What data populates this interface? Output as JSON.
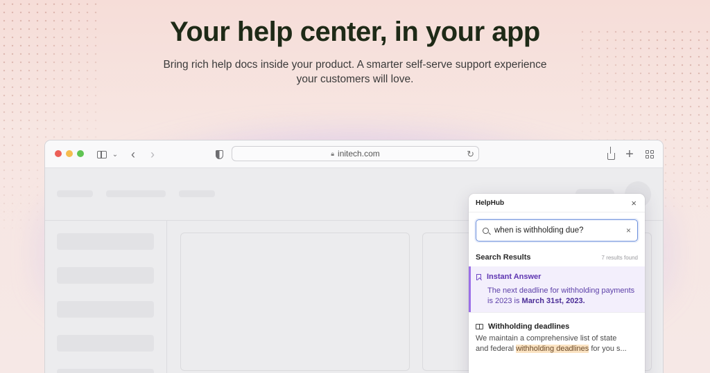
{
  "hero": {
    "title": "Your help center, in your app",
    "subtitle": "Bring rich help docs inside your product. A smarter self-serve support experience your customers will love."
  },
  "browser": {
    "url": "initech.com",
    "icons": [
      "sidebar-icon",
      "chevron-down-icon",
      "back-arrow-icon",
      "forward-arrow-icon",
      "shield-icon",
      "lock-icon",
      "reload-icon",
      "share-icon",
      "plus-icon",
      "tab-grid-icon"
    ]
  },
  "helphub": {
    "title": "HelpHub",
    "close_glyph": "×",
    "search_value": "when is withholding due?",
    "clear_glyph": "×",
    "results_title": "Search Results",
    "results_count": "7 results found",
    "instant_answer": {
      "title": "Instant Answer",
      "body_prefix": "The next deadline for withholding payments is 2023 is ",
      "body_emphasis": "March 31st, 2023."
    },
    "result2": {
      "title": "Withholding deadlines",
      "line1": "We maintain a comprehensive list of state",
      "line2_prefix": "and federal ",
      "line2_highlight": "withholding deadlines",
      "line2_suffix": " for you s..."
    }
  },
  "colors": {
    "accent_purple": "#9b6ee8",
    "search_focus": "#6b8fdc",
    "highlight": "#fbe3c2"
  }
}
